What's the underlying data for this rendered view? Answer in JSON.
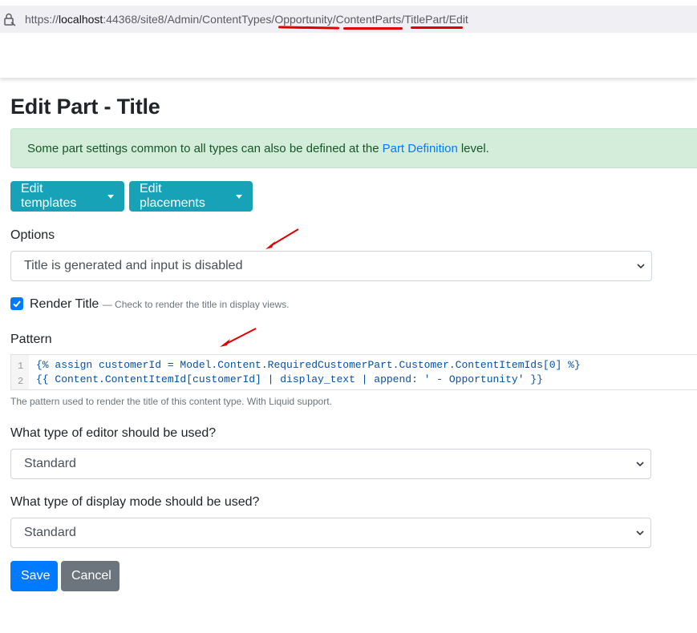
{
  "browser": {
    "url_prefix": "https://",
    "url_host": "localhost",
    "url_rest": ":44368/site8/Admin/ContentTypes/",
    "url_seg1": "Opportunity",
    "url_sep1": "/",
    "url_seg2": "ContentParts",
    "url_sep2": "/",
    "url_seg3": "TitlePart",
    "url_tail": "/Edit"
  },
  "page": {
    "title": "Edit Part - Title"
  },
  "alert": {
    "text_before": "Some part settings common to all types can also be defined at the",
    "link": "Part Definition",
    "text_after": "level."
  },
  "buttons": {
    "edit_templates": "Edit templates",
    "edit_placements": "Edit placements",
    "save": "Save",
    "cancel": "Cancel"
  },
  "options": {
    "label": "Options",
    "selected": "Title is generated and input is disabled"
  },
  "render_title": {
    "label": "Render Title",
    "hint": "— Check to render the title in display views.",
    "checked": true
  },
  "pattern": {
    "label": "Pattern",
    "lines": [
      "{% assign customerId = Model.Content.RequiredCustomerPart.Customer.ContentItemIds[0] %}",
      "{{ Content.ContentItemId[customerId] | display_text | append: ' - Opportunity' }}"
    ],
    "line_numbers": [
      "1",
      "2"
    ],
    "help": "The pattern used to render the title of this content type. With Liquid support."
  },
  "editor_type": {
    "label": "What type of editor should be used?",
    "selected": "Standard"
  },
  "display_mode": {
    "label": "What type of display mode should be used?",
    "selected": "Standard"
  },
  "colors": {
    "annotation_red": "#e00000",
    "info": "#17a2b8",
    "primary": "#007bff",
    "secondary": "#6c757d",
    "alert_bg": "#d4edda"
  }
}
